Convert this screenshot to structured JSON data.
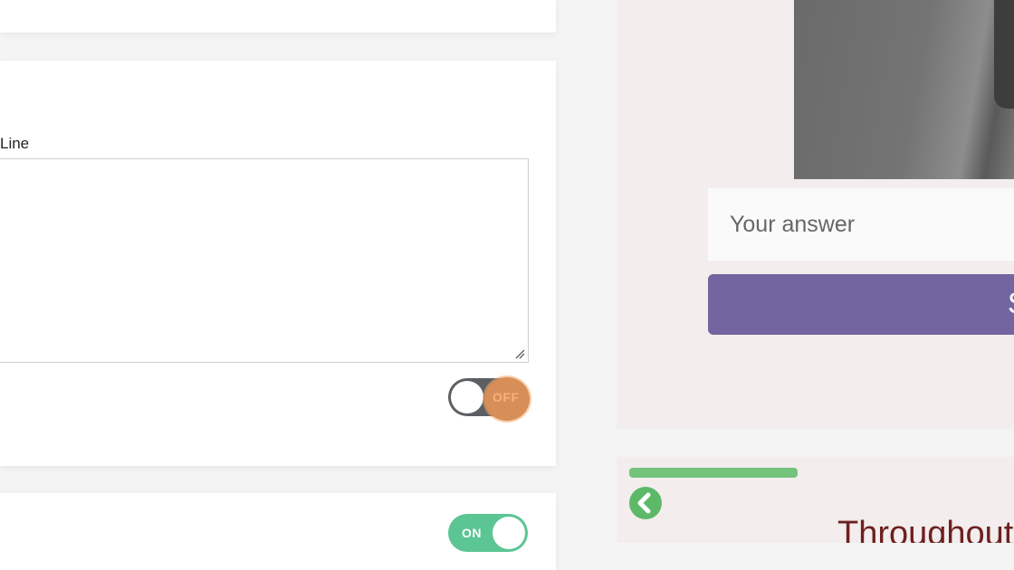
{
  "editor": {
    "field_label": "Line",
    "off_toggle": {
      "label": "OFF",
      "state": "off"
    },
    "on_toggle": {
      "label": "ON",
      "state": "on"
    }
  },
  "preview": {
    "answer_placeholder": "Your answer",
    "submit_label": "S",
    "progress": {
      "fraction": 1.0
    },
    "question_heading": "Throughout"
  },
  "colors": {
    "toggle_on": "#5cc594",
    "toggle_off": "#5c5f63",
    "accent_orange": "#d88e58",
    "submit_purple": "#73659f",
    "progress_green": "#73c37c",
    "heading_maroon": "#6e2020"
  },
  "icons": {
    "back": "chevron-left-icon",
    "resize": "resize-grip-icon"
  }
}
